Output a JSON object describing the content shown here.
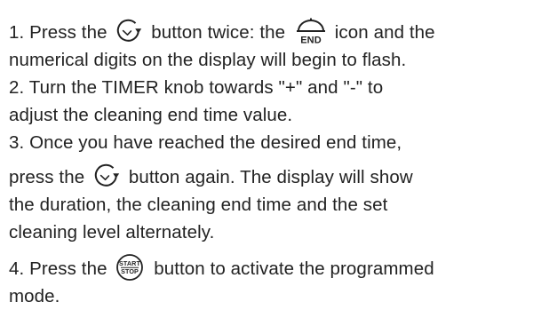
{
  "steps": [
    {
      "number": "1.",
      "before_icon1": " Press the",
      "icon1": "timer-button-icon",
      "between_icons": "button twice: the",
      "icon2": "end-cooking-icon",
      "icon2_text": "END",
      "after_icon2": "icon and the",
      "continuation": "numerical digits on the display will begin to flash."
    },
    {
      "number": "2.",
      "line1": " Turn the TIMER knob towards \"+\" and \"-\" to",
      "line2": "adjust the cleaning end time value."
    },
    {
      "number": "3.",
      "line1": " Once you have reached the desired end time,",
      "line2_before_icon": "press the",
      "icon": "timer-button-icon",
      "line2_after_icon": "button again. The display will show",
      "line3": "the duration, the cleaning end time and the set",
      "line4": "cleaning level alternately."
    },
    {
      "number": "4.",
      "before_icon": " Press the",
      "icon": "start-stop-button-icon",
      "icon_text_top": "START",
      "icon_text_bottom": "STOP",
      "after_icon": "button to activate the programmed",
      "continuation": "mode."
    }
  ]
}
